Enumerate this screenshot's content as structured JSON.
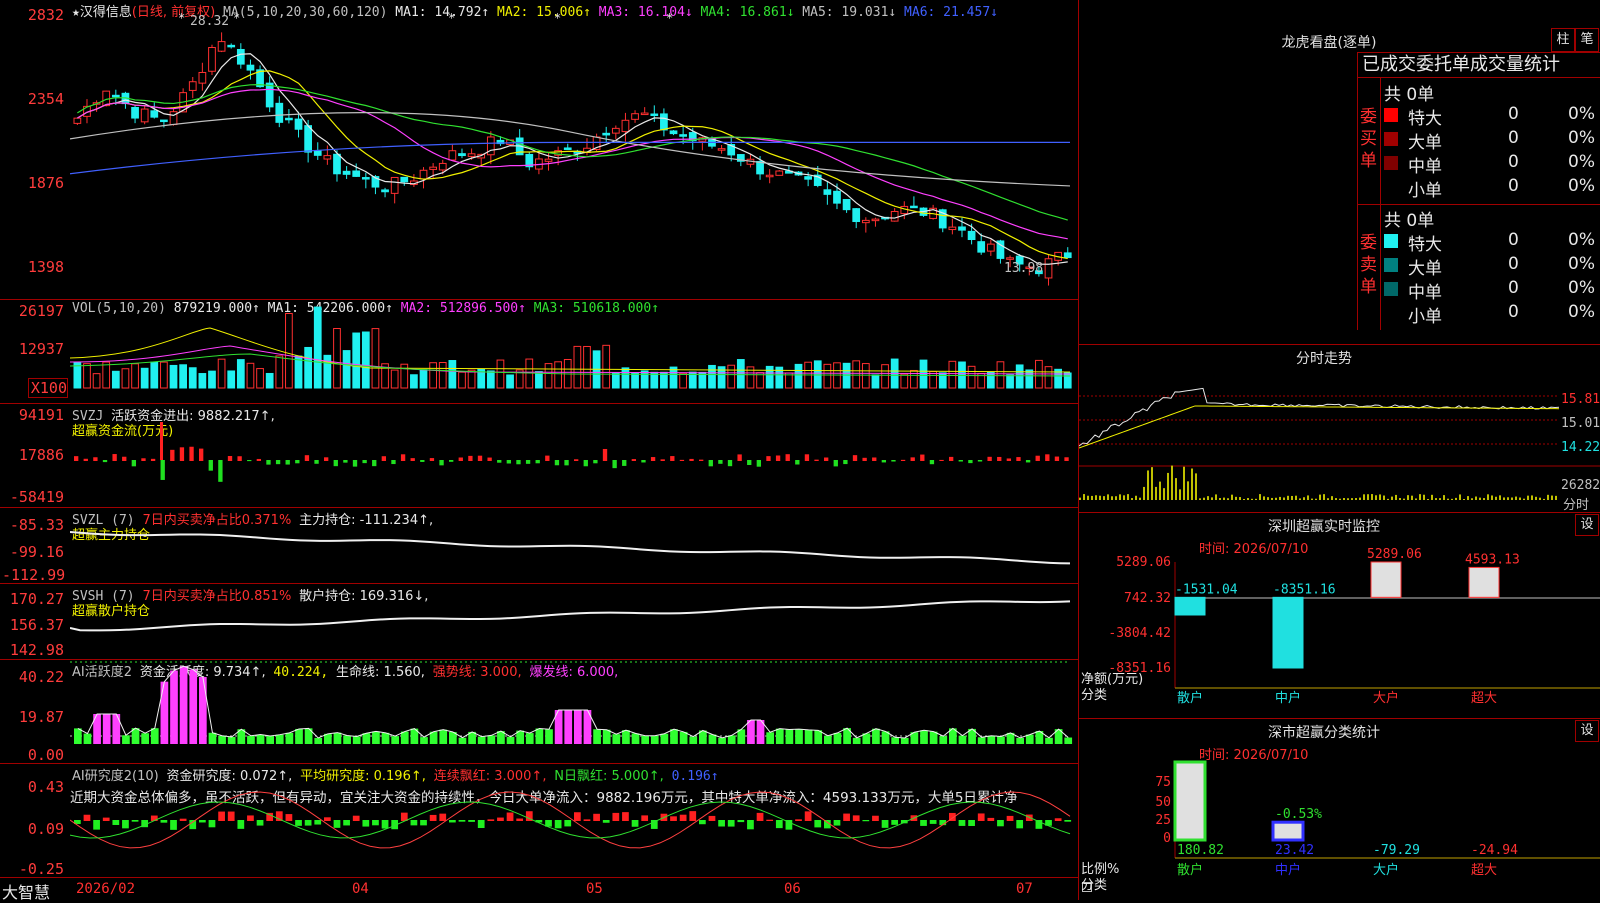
{
  "stock": {
    "star": "★",
    "name": "汉得信息",
    "period": "(日线, 前复权)",
    "ma_header": "MA(5,10,20,30,60,120)",
    "ma1": "MA1: 14.792↑",
    "ma2": "MA2: 15.006↑",
    "ma3": "MA3: 16.104↓",
    "ma4": "MA4: 16.861↓",
    "ma5": "MA5: 19.031↓",
    "ma6": "MA6: 21.457↓",
    "high_label": "28.32",
    "low_label": "13.98",
    "y_ticks": [
      "2832",
      "2354",
      "1876",
      "1398"
    ],
    "colors": {
      "up": "#ff3030",
      "down": "#20f0f0",
      "ma1": "#e8e8e8",
      "ma2": "#f0f000",
      "ma3": "#ff40ff",
      "ma4": "#30e030",
      "ma5": "#c0c0c0",
      "ma6": "#4060ff"
    }
  },
  "vol": {
    "header": "VOL(5,10,20)",
    "value": "879219.000↑",
    "ma1": "MA1: 542206.000↑",
    "ma2": "MA2: 512896.500↑",
    "ma3": "MA3: 510618.000↑",
    "y_ticks": [
      "26197",
      "12937",
      "X100"
    ]
  },
  "svzj": {
    "header": "SVZJ",
    "active": "活跃资金进出: 9882.217↑,",
    "title": "超赢资金流(万元)",
    "y_ticks": [
      "94191",
      "17886",
      "-58419"
    ]
  },
  "svzl": {
    "header": "SVZL (7)",
    "ratio": "7日内买卖净占比0.371%",
    "main": "主力持仓: -111.234↑,",
    "title": "超赢主力持仓",
    "y_ticks": [
      "-85.33",
      "-99.16",
      "-112.99"
    ]
  },
  "svsh": {
    "header": "SVSH (7)",
    "ratio": "7日内买卖净占比0.851%",
    "retail": "散户持仓: 169.316↓,",
    "title": "超赢散户持仓",
    "y_ticks": [
      "170.27",
      "156.37",
      "142.98"
    ]
  },
  "ai_active": {
    "header": "AI活跃度2",
    "activity": "资金活跃度: 9.734↑,",
    "v2": "40.224,",
    "life": "生命线: 1.560,",
    "strong": "强势线: 3.000,",
    "burst": "爆发线: 6.000,",
    "y_ticks": [
      "40.22",
      "19.87",
      "0.00"
    ]
  },
  "ai_research": {
    "header": "AI研究度2(10)",
    "research": "资金研究度: 0.072↑,",
    "avg": "平均研究度: 0.196↑,",
    "cont": "连续飘红: 3.000↑,",
    "n": "N日飘红: 5.000↑,",
    "v": "0.196↑",
    "comment": "近期大资金总体偏多，虽不活跃，但有异动，宜关注大资金的持续性，今日大单净流入：9882.196万元，其中特大单净流入：4593.133万元，大单5日累计净",
    "y_ticks": [
      "0.43",
      "0.09",
      "-0.25"
    ]
  },
  "footer": {
    "brand": "大智慧",
    "months": [
      "2026/02",
      "04",
      "05",
      "06",
      "07"
    ]
  },
  "dragon": {
    "title": "龙虎看盘(逐单)",
    "btn_bar": "柱",
    "btn_pen": "笔",
    "tab_label": "已成交委托单成交量统计",
    "buy_side": "委买单",
    "sell_side": "委卖单",
    "buy_total": "共 0单",
    "sell_total": "共 0单",
    "buy_rows": [
      {
        "label": "特大",
        "count": "0",
        "pct": "0%",
        "color": "#ff0000"
      },
      {
        "label": "大单",
        "count": "0",
        "pct": "0%",
        "color": "#a00000"
      },
      {
        "label": "中单",
        "count": "0",
        "pct": "0%",
        "color": "#800000"
      },
      {
        "label": "小单",
        "count": "0",
        "pct": "0%",
        "color": "#000000"
      }
    ],
    "sell_rows": [
      {
        "label": "特大",
        "count": "0",
        "pct": "0%",
        "color": "#20f0f0"
      },
      {
        "label": "大单",
        "count": "0",
        "pct": "0%",
        "color": "#008080"
      },
      {
        "label": "中单",
        "count": "0",
        "pct": "0%",
        "color": "#006868"
      },
      {
        "label": "小单",
        "count": "0",
        "pct": "0%",
        "color": "#000000"
      }
    ]
  },
  "intraday": {
    "title": "分时走势",
    "price_ticks": [
      "15.81",
      "15.01",
      "14.22"
    ],
    "vol_top": "26282",
    "vol_label": "分时"
  },
  "monitor": {
    "title": "深圳超赢实时监控",
    "btn": "设",
    "time": "时间: 2026/07/10",
    "y_ticks": [
      "5289.06",
      "742.32",
      "-3804.42",
      "-8351.16"
    ],
    "y_label": "净额(万元)",
    "x_label": "分类",
    "bars": [
      {
        "cat": "散户",
        "value": -1531.04,
        "label": "-1531.04"
      },
      {
        "cat": "中户",
        "value": -8351.16,
        "label": "-8351.16"
      },
      {
        "cat": "大户",
        "value": 5289.06,
        "label": "5289.06"
      },
      {
        "cat": "超大",
        "value": 4593.13,
        "label": "4593.13"
      }
    ]
  },
  "stats": {
    "title": "深市超赢分类统计",
    "btn": "设",
    "time": "时间: 2026/07/10",
    "y_ticks": [
      "75",
      "50",
      "25",
      "0"
    ],
    "y_label": "比例%",
    "x_label": "分类",
    "bars": [
      {
        "cat": "散户",
        "value": 180.82,
        "label": "180.82",
        "color": "#30e030"
      },
      {
        "cat": "中户",
        "value": 23.42,
        "label": "23.42",
        "color": "#3030ff"
      },
      {
        "cat": "大户",
        "value": -79.29,
        "label": "-79.29",
        "color": "#20e0e0"
      },
      {
        "cat": "超大",
        "value": -24.94,
        "label": "-24.94",
        "color": "#ff3030"
      }
    ],
    "extra_label": "-0.53%"
  }
}
